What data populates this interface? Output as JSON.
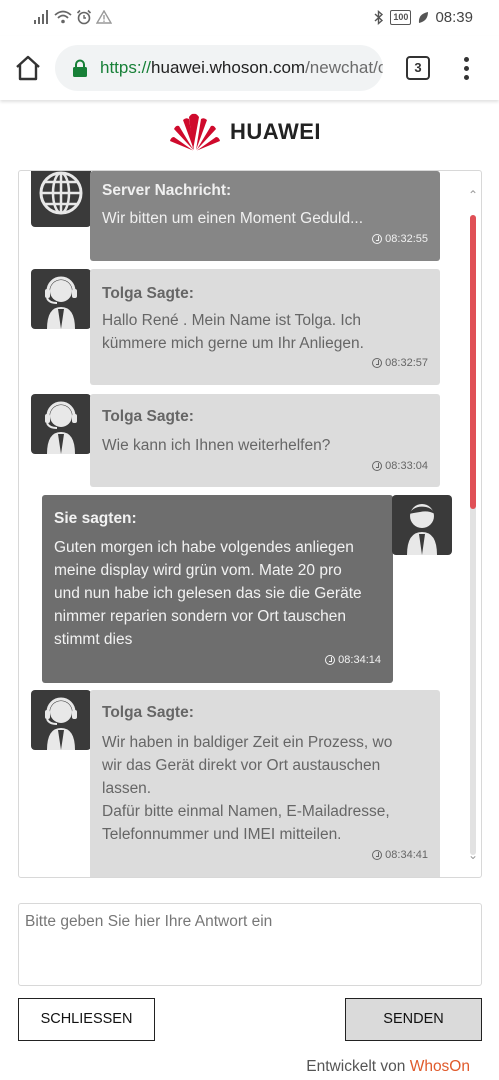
{
  "status_bar": {
    "battery": "100",
    "time": "08:39"
  },
  "browser": {
    "url_protocol": "https://",
    "url_host": "huawei.whoson.com",
    "url_path": "/newchat/c",
    "tab_count": "3"
  },
  "header": {
    "logo_text": "HUAWEI"
  },
  "chat": {
    "messages": [
      {
        "type": "server",
        "title": "Server Nachricht:",
        "text": "Wir bitten um einen Moment Geduld...",
        "time": "08:32:55"
      },
      {
        "type": "agent",
        "title": "Tolga Sagte:",
        "text": "Hallo René . Mein Name ist Tolga. Ich\nkümmere mich gerne um Ihr Anliegen.",
        "time": "08:32:57"
      },
      {
        "type": "agent",
        "title": "Tolga Sagte:",
        "text": "Wie kann ich Ihnen weiterhelfen?",
        "time": "08:33:04"
      },
      {
        "type": "user",
        "title": "Sie sagten:",
        "text": "Guten morgen ich habe volgendes anliegen\nmeine display wird grün vom. Mate 20 pro\nund nun habe ich gelesen das sie die Geräte\nnimmer reparien sondern vor Ort tauschen\nstimmt dies",
        "time": "08:34:14"
      },
      {
        "type": "agent",
        "title": "Tolga Sagte:",
        "text": "Wir haben in baldiger Zeit ein Prozess, wo\nwir das Gerät direkt vor Ort austauschen\nlassen.\nDafür bitte einmal Namen, E-Mailadresse,\nTelefonnummer und IMEI mitteilen.",
        "time": "08:34:41"
      }
    ],
    "scroll_position_fraction": 0.0,
    "scroll_thumb_fraction": 0.46
  },
  "reply": {
    "placeholder": "Bitte geben Sie hier Ihre Antwort ein"
  },
  "buttons": {
    "close_label": "SCHLIESSEN",
    "send_label": "SENDEN"
  },
  "footer": {
    "prefix": "Entwickelt von ",
    "brand": "WhosOn"
  },
  "colors": {
    "brand_red": "#cf0a2c",
    "scroll_thumb": "#e05056",
    "footer_brand": "#e05a2b"
  }
}
